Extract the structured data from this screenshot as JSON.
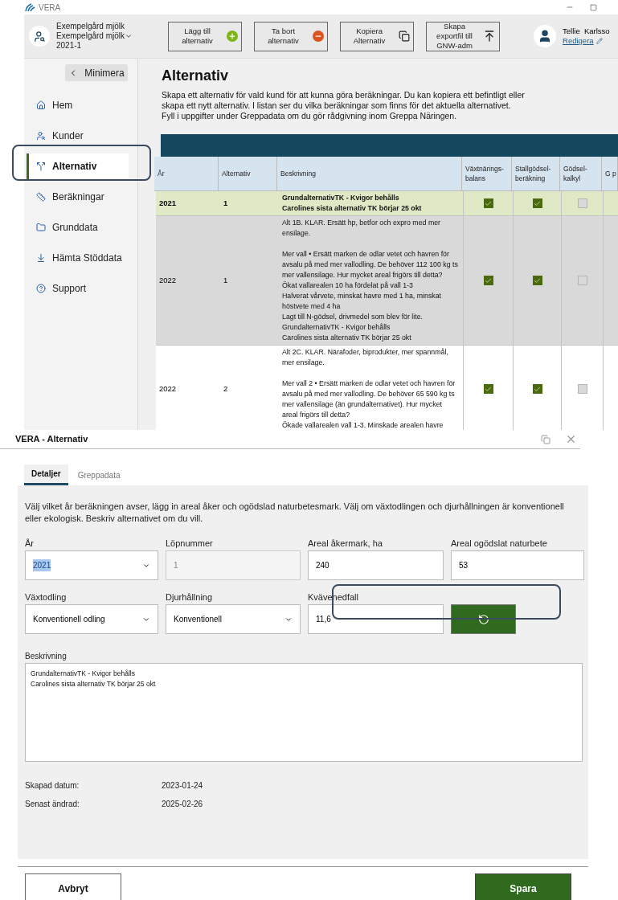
{
  "app": {
    "title": "VERA",
    "customer": {
      "name": "Exempelgård mjölk",
      "farm": "Exempelgård mjölk",
      "code": "2021-1"
    },
    "toolbar": [
      {
        "label": "Lägg till alternativ",
        "kind": "add"
      },
      {
        "label": "Ta bort alternativ",
        "kind": "remove"
      },
      {
        "label": "Kopiera Alternativ",
        "kind": "copy"
      },
      {
        "label": "Skapa exportfil till GNW-adm",
        "kind": "export"
      }
    ],
    "user": {
      "name": "Tellie  Karlsso",
      "edit_link": "Redigera"
    }
  },
  "sidebar": {
    "collapse_button": "Minimera",
    "items": [
      {
        "label": "Hem",
        "selected": false
      },
      {
        "label": "Kunder",
        "selected": false
      },
      {
        "label": "Alternativ",
        "selected": true
      },
      {
        "label": "Beräkningar",
        "selected": false
      },
      {
        "label": "Grunddata",
        "selected": false
      },
      {
        "label": "Hämta Stöddata",
        "selected": false
      },
      {
        "label": "Support",
        "selected": false
      }
    ]
  },
  "page": {
    "title": "Alternativ",
    "intro": "Skapa ett alternativ för vald kund för att kunna göra beräkningar. Du kan kopiera ett befintligt eller skapa ett nytt alternativ. I listan ser du vilka beräkningar som finns för det aktuella alternativet.",
    "note": "Fyll i uppgifter under Greppadata om du gör rådgivning inom Greppa Näringen."
  },
  "table": {
    "columns": [
      "År",
      "Alternativ",
      "Beskrivning",
      "Växtnärings-balans",
      "Stallgödsel-beräkning",
      "Gödsel-kalkyl",
      "G p"
    ],
    "rows": [
      {
        "year": "2021",
        "alternative": "1",
        "description": "GrundalternativTK - Kvigor behålls\nCarolines sista alternativ TK börjar 25 okt",
        "selected": true,
        "checks": [
          true,
          true,
          false
        ]
      },
      {
        "year": "2022",
        "alternative": "1",
        "description": "Alt 1B. KLAR. Ersätt hp, betfor och expro med mer ensilage.\n\nMer vall • Ersätt marken de odlar vetet och havren för avsalu på med mer vallodling. De behöver 112 100 kg ts mer vallensilage. Hur mycket areal frigörs till detta?\nÖkat vallarealen 10 ha fördelat på vall 1-3\nHalverat vårvete, minskat havre med 1 ha, minskat höstvete med 4 ha\nLagt till N-gödsel, drivmedel som blev för lite.\nGrundalternativTK - Kvigor behålls\nCarolines sista alternativ TK börjar 25 okt",
        "selected": false,
        "checks": [
          true,
          true,
          false
        ]
      },
      {
        "year": "2022",
        "alternative": "2",
        "description": "Alt 2C. KLAR. Närafoder, biprodukter, mer spannmål, mer ensilage.\n\nMer vall 2 • Ersätt marken de odlar vetet och havren för avsalu på med mer vallodling. De behöver 65 590 kg ts mer vallensilage (än grundalternativet). Hur mycket areal frigörs till detta?\nÖkade vallarealen vall 1-3. Minskade arealen havre",
        "selected": false,
        "checks": [
          true,
          true,
          false
        ]
      }
    ]
  },
  "dialog": {
    "title": "VERA - Alternativ",
    "tabs": [
      {
        "label": "Detaljer",
        "selected": true
      },
      {
        "label": "Greppadata",
        "selected": false
      }
    ],
    "instructions": "Välj vilket år beräkningen avser, lägg in areal åker och ogödslad naturbetesmark. Välj om växtodlingen och djurhållningen är konventionell eller ekologisk. Beskriv alternativet om du vill.",
    "fields": [
      {
        "label": "År",
        "value": "2021",
        "kind": "select",
        "text_selected": true
      },
      {
        "label": "Löpnummer",
        "value": "1",
        "kind": "readonly",
        "text_selected": false
      },
      {
        "label": "Areal åkermark, ha",
        "value": "240",
        "kind": "text",
        "text_selected": false
      },
      {
        "label": "Areal ogödslat naturbete",
        "value": "53",
        "kind": "text",
        "text_selected": false
      },
      {
        "label": "Växtodling",
        "value": "Konventionell odling",
        "kind": "select",
        "text_selected": false
      },
      {
        "label": "Djurhållning",
        "value": "Konventionell",
        "kind": "select",
        "text_selected": false
      },
      {
        "label": "Kvävenedfall",
        "value": "11,6",
        "kind": "text",
        "text_selected": false
      },
      {
        "kind": "refresh"
      }
    ],
    "description": {
      "label": "Beskrivning",
      "value": "GrundalternativTK - Kvigor behålls\nCarolines sista alternativ TK börjar 25 okt"
    },
    "meta": [
      {
        "label": "Skapad datum:",
        "value": "2023-01-24"
      },
      {
        "label": "Senast ändrad:",
        "value": "2025-02-26"
      }
    ],
    "buttons": [
      {
        "label": "Avbryt",
        "kind": "secondary"
      },
      {
        "label": "Spara",
        "kind": "primary"
      }
    ]
  }
}
